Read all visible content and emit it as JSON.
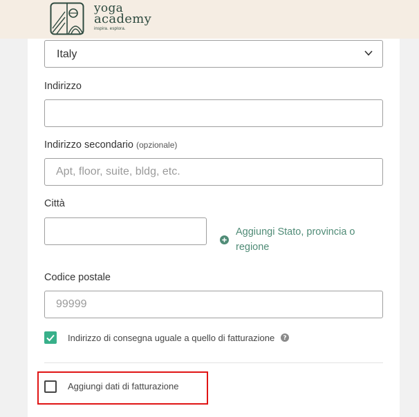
{
  "brand": {
    "name_line1": "yoga",
    "name_line2": "academy",
    "tagline": "inspira. esplora.",
    "color": "#2e4a3f",
    "header_bg": "#f5ede3"
  },
  "form": {
    "country": {
      "selected": "Italy",
      "icon": "chevron-down-icon"
    },
    "address": {
      "label": "Indirizzo",
      "value": "",
      "placeholder": ""
    },
    "address2": {
      "label": "Indirizzo secondario",
      "optional": "(opzionale)",
      "value": "",
      "placeholder": "Apt, floor, suite, bldg, etc."
    },
    "city": {
      "label": "Città",
      "value": "",
      "placeholder": ""
    },
    "add_state": {
      "label": "Aggiungi Stato, provincia o regione",
      "icon": "plus-circle-icon",
      "color": "#4f8b76"
    },
    "postal_code": {
      "label": "Codice postale",
      "value": "",
      "placeholder": "99999"
    },
    "same_address": {
      "label": "Indirizzo di consegna uguale a quello di fatturazione",
      "checked": true,
      "color": "#38b08a",
      "help_icon": "question-circle-icon"
    },
    "billing": {
      "label": "Aggiungi dati di fatturazione",
      "checked": false,
      "highlight_color": "#e01414"
    }
  }
}
